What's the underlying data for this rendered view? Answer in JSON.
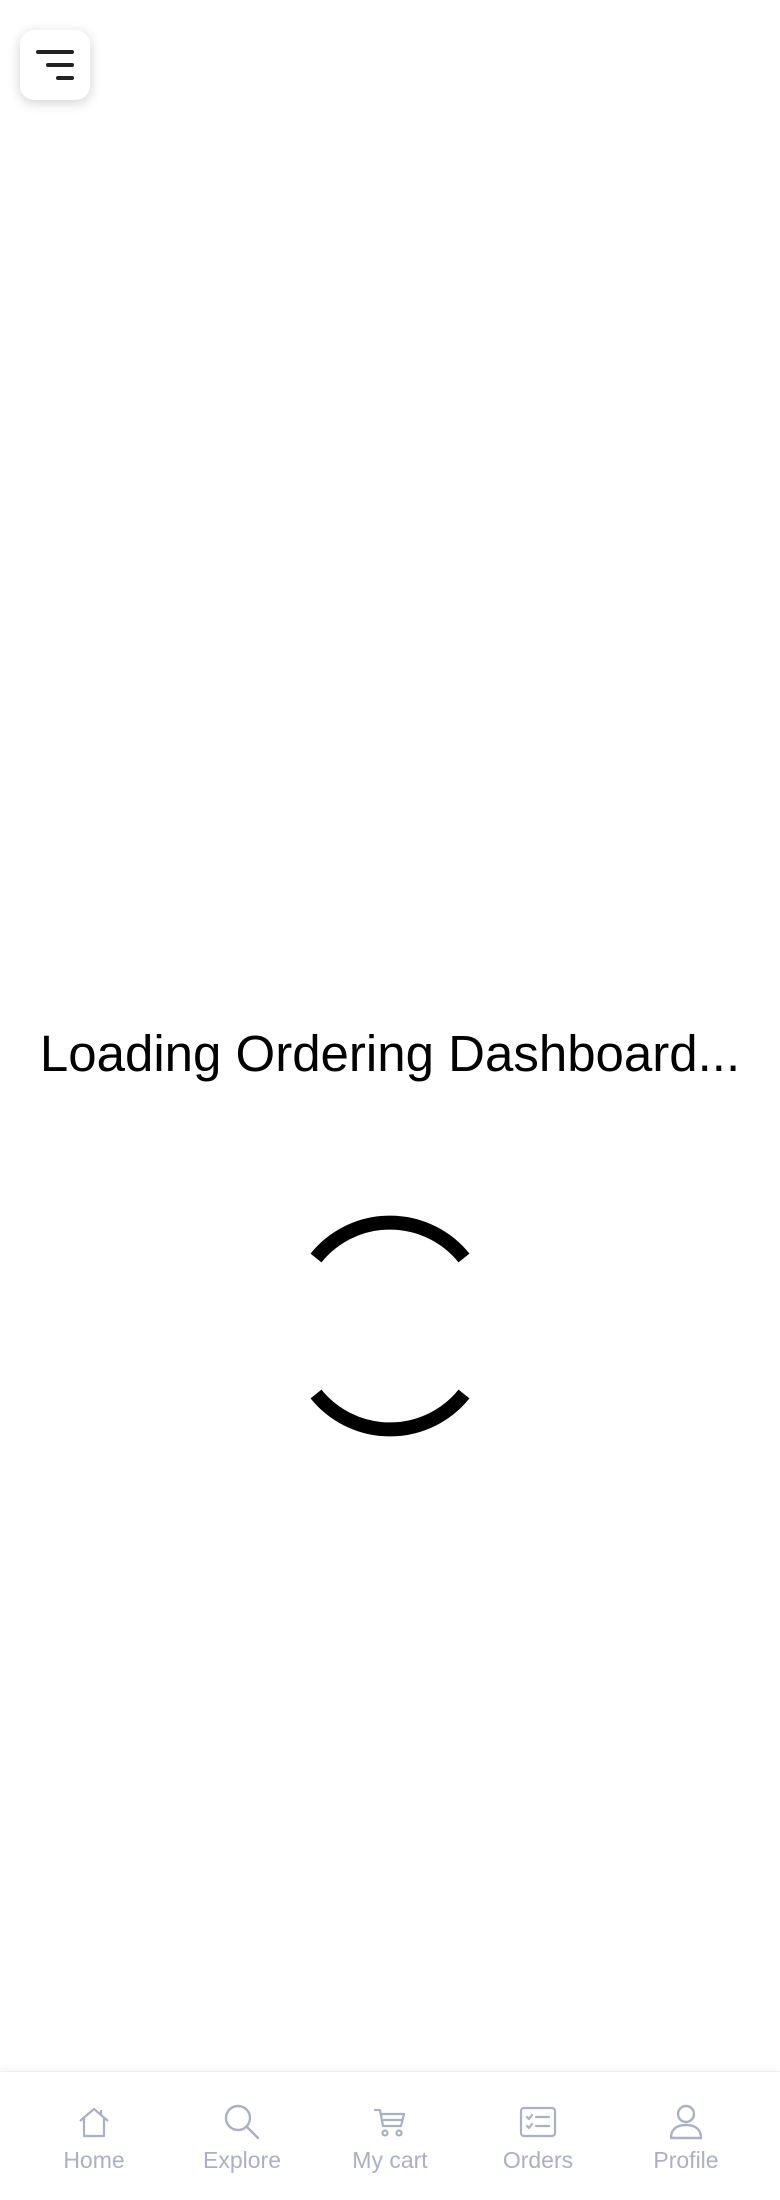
{
  "menu": {
    "icon": "menu-lines-icon"
  },
  "loading": {
    "title": "Loading Ordering Dashboard..."
  },
  "spinner": {
    "icon": "loading-spinner-icon"
  },
  "bottom_nav": {
    "items": [
      {
        "label": "Home",
        "icon": "home-icon"
      },
      {
        "label": "Explore",
        "icon": "search-icon"
      },
      {
        "label": "My cart",
        "icon": "cart-icon"
      },
      {
        "label": "Orders",
        "icon": "orders-list-icon"
      },
      {
        "label": "Profile",
        "icon": "user-icon"
      }
    ]
  },
  "colors": {
    "background": "#ffffff",
    "nav_inactive": "#a9b1c2",
    "text": "#000000"
  }
}
